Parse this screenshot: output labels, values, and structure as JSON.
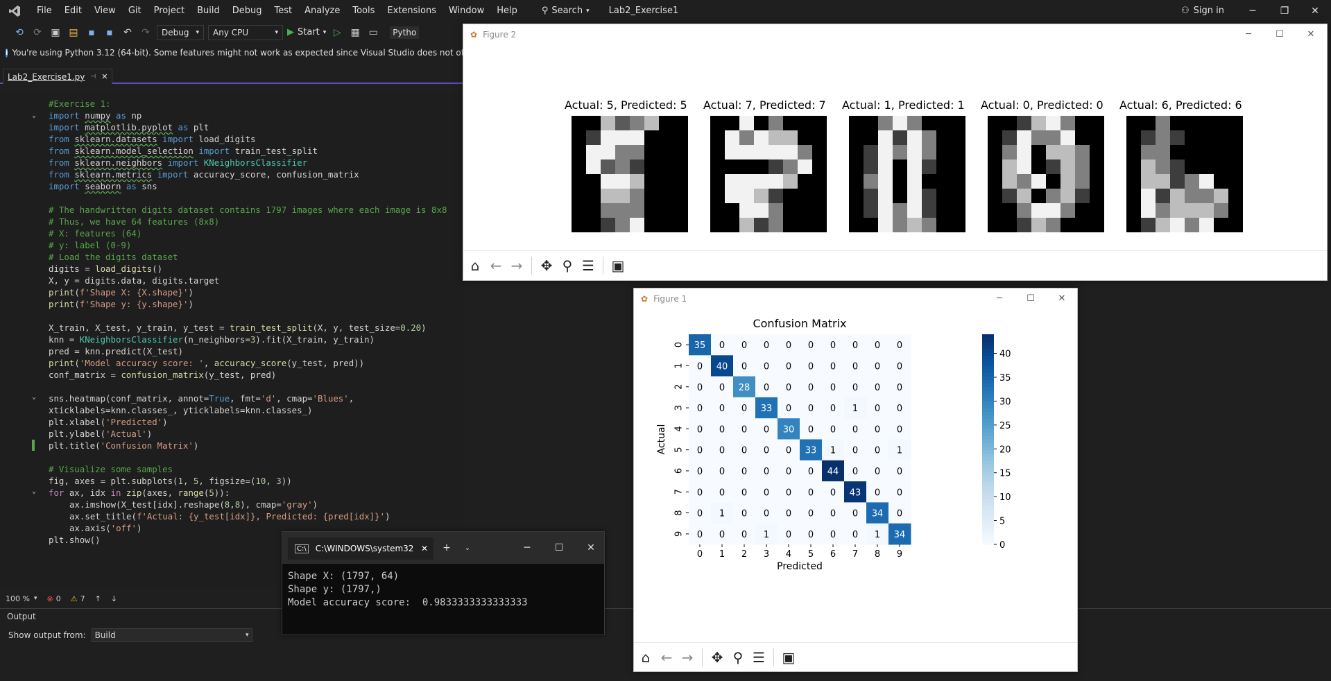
{
  "menubar": {
    "items": [
      "File",
      "Edit",
      "View",
      "Git",
      "Project",
      "Build",
      "Debug",
      "Test",
      "Analyze",
      "Tools",
      "Extensions",
      "Window",
      "Help"
    ],
    "search": "Search",
    "solution": "Lab2_Exercise1",
    "signin": "Sign in"
  },
  "toolbar": {
    "config": "Debug",
    "platform": "Any CPU",
    "start": "Start",
    "env": "Pytho"
  },
  "infobar": {
    "text": "You're using Python 3.12 (64-bit). Some features might not work as expected since Visual Studio does not officially suppor"
  },
  "tab": {
    "name": "Lab2_Exercise1.py"
  },
  "status": {
    "zoom": "100 %",
    "errors": "0",
    "warnings": "7"
  },
  "output": {
    "title": "Output",
    "from_label": "Show output from:",
    "from_value": "Build"
  },
  "figure2": {
    "title": "Figure 2",
    "samples": [
      {
        "title": "Actual: 5, Predicted: 5"
      },
      {
        "title": "Actual: 7, Predicted: 7"
      },
      {
        "title": "Actual: 1, Predicted: 1"
      },
      {
        "title": "Actual: 0, Predicted: 0"
      },
      {
        "title": "Actual: 6, Predicted: 6"
      }
    ]
  },
  "figure1": {
    "title": "Figure 1"
  },
  "console": {
    "tab_title": "C:\\WINDOWS\\system32",
    "lines": [
      "Shape X: (1797, 64)",
      "Shape y: (1797,)",
      "Model accuracy score:  0.9833333333333333"
    ]
  },
  "chart_data": {
    "type": "heatmap",
    "title": "Confusion Matrix",
    "xlabel": "Predicted",
    "ylabel": "Actual",
    "x_categories": [
      "0",
      "1",
      "2",
      "3",
      "4",
      "5",
      "6",
      "7",
      "8",
      "9"
    ],
    "y_categories": [
      "0",
      "1",
      "2",
      "3",
      "4",
      "5",
      "6",
      "7",
      "8",
      "9"
    ],
    "matrix": [
      [
        35,
        0,
        0,
        0,
        0,
        0,
        0,
        0,
        0,
        0
      ],
      [
        0,
        40,
        0,
        0,
        0,
        0,
        0,
        0,
        0,
        0
      ],
      [
        0,
        0,
        28,
        0,
        0,
        0,
        0,
        0,
        0,
        0
      ],
      [
        0,
        0,
        0,
        33,
        0,
        0,
        0,
        1,
        0,
        0
      ],
      [
        0,
        0,
        0,
        0,
        30,
        0,
        0,
        0,
        0,
        0
      ],
      [
        0,
        0,
        0,
        0,
        0,
        33,
        1,
        0,
        0,
        1
      ],
      [
        0,
        0,
        0,
        0,
        0,
        0,
        44,
        0,
        0,
        0
      ],
      [
        0,
        0,
        0,
        0,
        0,
        0,
        0,
        43,
        0,
        0
      ],
      [
        0,
        1,
        0,
        0,
        0,
        0,
        0,
        0,
        34,
        0
      ],
      [
        0,
        0,
        0,
        1,
        0,
        0,
        0,
        0,
        1,
        34
      ]
    ],
    "colorbar_ticks": [
      0,
      5,
      10,
      15,
      20,
      25,
      30,
      35,
      40
    ],
    "vmin": 0,
    "vmax": 44,
    "colormap": "Blues"
  }
}
